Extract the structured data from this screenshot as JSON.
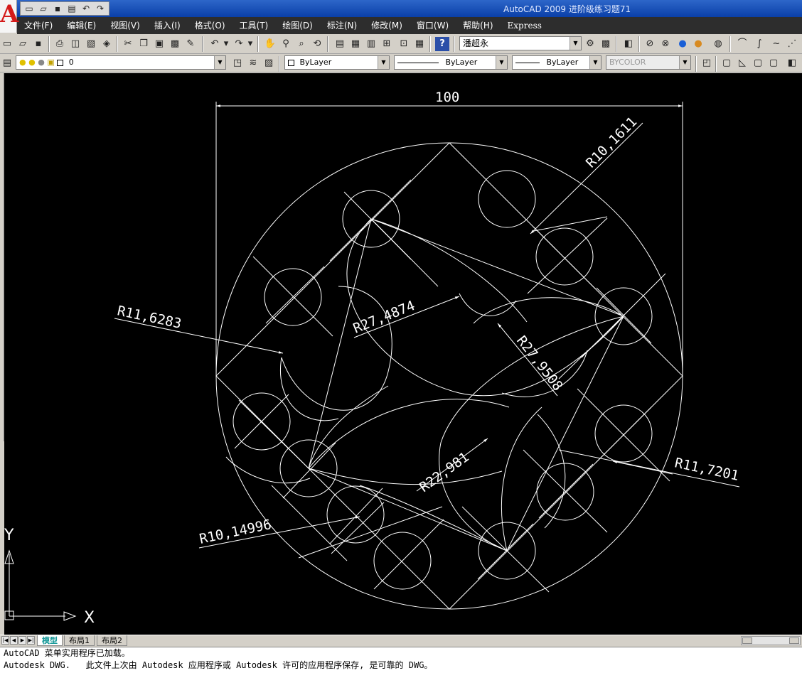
{
  "window": {
    "title": "AutoCAD 2009  进阶级练习题71",
    "logo_letter": "A"
  },
  "menu": [
    "文件(F)",
    "编辑(E)",
    "视图(V)",
    "插入(I)",
    "格式(O)",
    "工具(T)",
    "绘图(D)",
    "标注(N)",
    "修改(M)",
    "窗口(W)",
    "帮助(H)",
    "Express"
  ],
  "toolbar": {
    "text_style_value": "潘超永"
  },
  "layers": {
    "layer_value": "0",
    "color_value": "ByLayer",
    "linetype_value": "ByLayer",
    "lineweight_value": "ByLayer",
    "plotstyle_value": "BYCOLOR"
  },
  "drawing": {
    "dimensions": [
      "100",
      "R10,1611",
      "R11,6283",
      "R27,4874",
      "R27,9508",
      "R22,981",
      "R11,7201",
      "R10,14996"
    ],
    "ucs": {
      "y_label": "Y",
      "x_label": "X"
    }
  },
  "layout_tabs": [
    "模型",
    "布局1",
    "布局2"
  ],
  "command_lines": [
    "AutoCAD 菜单实用程序已加载。",
    "Autodesk DWG.   此文件上次由 Autodesk 应用程序或 Autodesk 许可的应用程序保存, 是可靠的 DWG。"
  ],
  "icons": [
    "new-icon",
    "open-icon",
    "save-icon",
    "print-icon",
    "undo-icon",
    "redo-icon",
    "cut-icon",
    "copy-icon",
    "paste-icon",
    "zoom-icon",
    "pan-icon",
    "help-icon",
    "lightbulb-icon",
    "sun-icon",
    "lock-icon"
  ]
}
